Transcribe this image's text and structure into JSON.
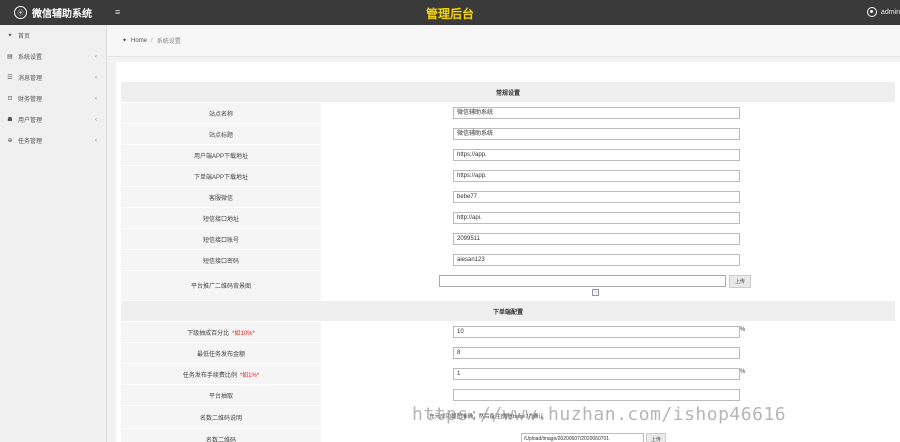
{
  "header": {
    "brand_logo": "⦿",
    "brand_title": "微信辅助系统",
    "menu_icon": "≡",
    "page_title": "管理后台",
    "user_name": "admin"
  },
  "sidebar": {
    "items": [
      {
        "icon": "home-icon",
        "glyph": "✦",
        "label": "首页",
        "arrow": ""
      },
      {
        "icon": "settings-icon",
        "glyph": "▤",
        "label": "系统设置",
        "arrow": "‹"
      },
      {
        "icon": "message-icon",
        "glyph": "☰",
        "label": "消息管理",
        "arrow": "‹"
      },
      {
        "icon": "finance-icon",
        "glyph": "⊡",
        "label": "财务管理",
        "arrow": "‹"
      },
      {
        "icon": "users-icon",
        "glyph": "☗",
        "label": "用户管理",
        "arrow": "‹"
      },
      {
        "icon": "task-icon",
        "glyph": "⊕",
        "label": "任务管理",
        "arrow": "‹"
      }
    ]
  },
  "breadcrumb": {
    "home_glyph": "✦",
    "home": "Home",
    "separator": "/",
    "current": "系统设置"
  },
  "form": {
    "section1": "常规设置",
    "section2": "下单端配置",
    "rows": [
      {
        "label": "站点名称",
        "value": "微信辅助系统"
      },
      {
        "label": "站点标题",
        "value": "微信辅助系统"
      },
      {
        "label": "用户端APP下载地址",
        "value": "https://app."
      },
      {
        "label": "下单端APP下载地址",
        "value": "https://app."
      },
      {
        "label": "客服微信",
        "value": "bebe77"
      },
      {
        "label": "短信接口地址",
        "value": "http://api."
      },
      {
        "label": "短信接口账号",
        "value": "2099511"
      },
      {
        "label": "短信接口密码",
        "value": "aiesan123"
      }
    ],
    "promo_label": "平台推广二维码背景图",
    "upload_label": "上传",
    "section2_rows": [
      {
        "label": "下级抽成百分比",
        "hint": "*如10%*",
        "value": "10",
        "suffix": "%"
      },
      {
        "label": "最低任务发布金额",
        "hint": "",
        "value": "8",
        "suffix": ""
      },
      {
        "label": "任务发布手续费比例",
        "hint": "*如1%*",
        "value": "1",
        "suffix": "%"
      },
      {
        "label": "平台抽取",
        "hint": "",
        "value": "",
        "suffix": ""
      }
    ],
    "qr_desc_label": "名数二维码说明",
    "qr_desc_text": "充元成功截图准确，然后备注[微信bebe77]确认",
    "qr_label": "名数二维码",
    "qr_path": "/Upload/image/20200607/2020060701",
    "qr_upload_label": "上传"
  },
  "watermark": "https://www.huzhan.com/ishop46616"
}
